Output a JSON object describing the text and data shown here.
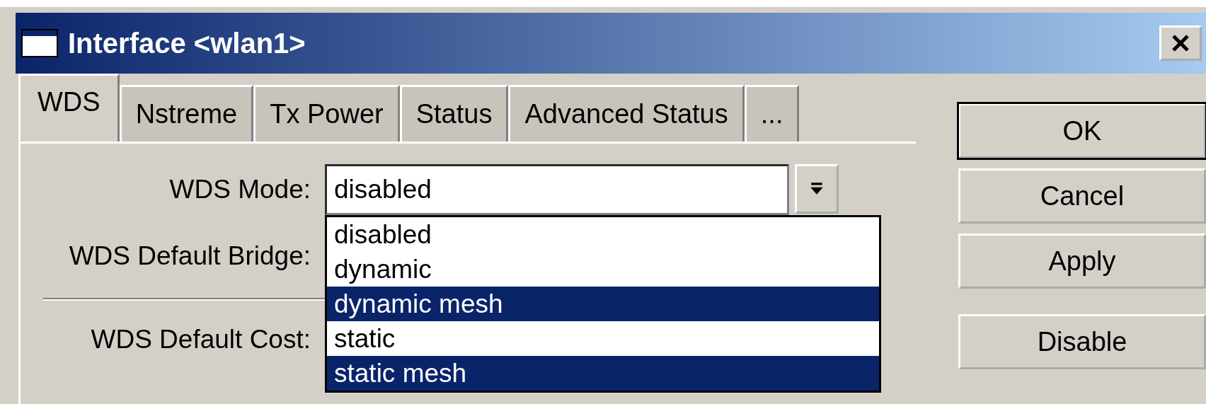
{
  "window": {
    "title": "Interface <wlan1>"
  },
  "tabs": [
    {
      "label": "WDS",
      "selected": true
    },
    {
      "label": "Nstreme",
      "selected": false
    },
    {
      "label": "Tx Power",
      "selected": false
    },
    {
      "label": "Status",
      "selected": false
    },
    {
      "label": "Advanced Status",
      "selected": false
    },
    {
      "label": "...",
      "selected": false
    }
  ],
  "fields": [
    {
      "label": "WDS Mode:",
      "kind": "dropdown",
      "value": "disabled"
    },
    {
      "label": "WDS Default Bridge:",
      "kind": "hidden"
    },
    {
      "label": "WDS Default Cost:",
      "kind": "hidden"
    }
  ],
  "dropdown_options": [
    {
      "label": "disabled",
      "selected": false
    },
    {
      "label": "dynamic",
      "selected": false
    },
    {
      "label": "dynamic mesh",
      "selected": true
    },
    {
      "label": "static",
      "selected": false
    },
    {
      "label": "static mesh",
      "selected": true
    }
  ],
  "buttons": [
    {
      "label": "OK",
      "default": true
    },
    {
      "label": "Cancel",
      "default": false
    },
    {
      "label": "Apply",
      "default": false
    },
    {
      "label": "Disable",
      "default": false
    }
  ]
}
